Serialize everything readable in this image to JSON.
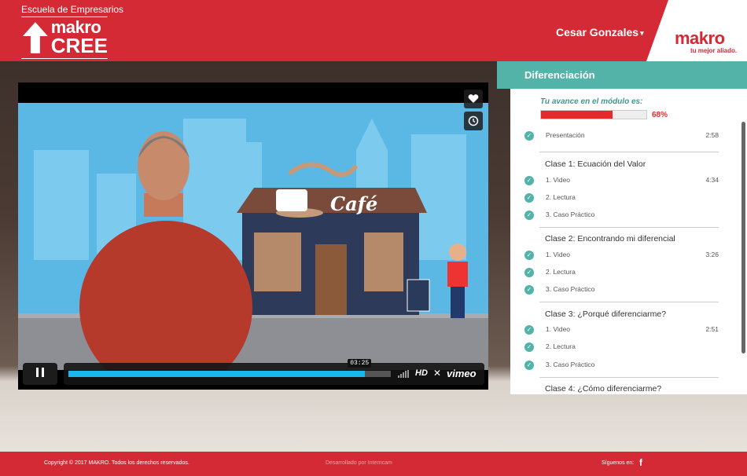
{
  "header": {
    "brand_top": "Escuela de Empresarios",
    "brand_word1": "makro",
    "brand_word2": "CREE",
    "user_name": "Cesar Gonzales",
    "logo_name": "makro",
    "logo_tagline": "tu mejor aliado."
  },
  "video": {
    "time": "03:25",
    "progress": 0.92,
    "hd_label": "HD",
    "vimeo_label": "vimeo",
    "cafe_sign": "Café"
  },
  "sidebar": {
    "title": "Diferenciación",
    "avance_label": "Tu avance en el módulo es:",
    "avance_pct": "68%",
    "avance_value": 0.68,
    "presentacion": {
      "label": "Presentación",
      "duration": "2:58"
    },
    "classes": [
      {
        "title": "Clase 1: Ecuación del Valor",
        "items": [
          {
            "label": "1. Video",
            "duration": "4:34"
          },
          {
            "label": "2. Lectura",
            "duration": ""
          },
          {
            "label": "3. Caso Práctico",
            "duration": ""
          }
        ]
      },
      {
        "title": "Clase 2: Encontrando mi diferencial",
        "items": [
          {
            "label": "1. Video",
            "duration": "3:26"
          },
          {
            "label": "2. Lectura",
            "duration": ""
          },
          {
            "label": "3. Caso Práctico",
            "duration": ""
          }
        ]
      },
      {
        "title": "Clase 3: ¿Porqué diferenciarme?",
        "items": [
          {
            "label": "1. Video",
            "duration": "2:51"
          },
          {
            "label": "2. Lectura",
            "duration": ""
          },
          {
            "label": "3. Caso Práctico",
            "duration": ""
          }
        ]
      },
      {
        "title": "Clase 4: ¿Cómo diferenciarme?",
        "items": []
      }
    ]
  },
  "footer": {
    "copyright": "Copyright © 2017 MAKRO. Todos los derechos reservados.",
    "developed": "Desarrollado por Interncam",
    "follow": "Síguenos en:",
    "facebook": "f"
  },
  "colors": {
    "brand_red": "#d42a35",
    "teal": "#53b3a8",
    "progress_red": "#e52a2a",
    "vimeo_blue": "#1ab7ea"
  }
}
